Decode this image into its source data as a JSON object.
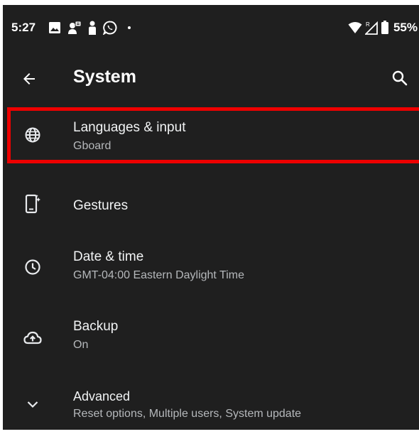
{
  "status_bar": {
    "time": "5:27",
    "left_icons": [
      "image-icon",
      "sim-card-icon",
      "person-icon",
      "whatsapp-icon"
    ],
    "right_icons": [
      "wifi-icon",
      "signal-roaming-icon",
      "battery-icon"
    ],
    "roaming_label": "R",
    "battery_percent": "55%"
  },
  "app_bar": {
    "title": "System",
    "back_icon": "arrow-back-icon",
    "search_icon": "search-icon"
  },
  "settings": {
    "items": [
      {
        "id": "languages",
        "icon": "globe-icon",
        "title": "Languages & input",
        "subtitle": "Gboard",
        "highlighted": true
      },
      {
        "id": "gestures",
        "icon": "phone-gesture-icon",
        "title": "Gestures",
        "subtitle": ""
      },
      {
        "id": "datetime",
        "icon": "clock-icon",
        "title": "Date & time",
        "subtitle": "GMT-04:00 Eastern Daylight Time"
      },
      {
        "id": "backup",
        "icon": "cloud-upload-icon",
        "title": "Backup",
        "subtitle": "On"
      },
      {
        "id": "advanced",
        "icon": "chevron-down-icon",
        "title": "Advanced",
        "subtitle": "Reset options, Multiple users, System update"
      }
    ]
  },
  "colors": {
    "background": "#1f1f1f",
    "text_primary": "#f1f3f4",
    "text_secondary": "#b5b8bb",
    "highlight": "#ee0000"
  }
}
